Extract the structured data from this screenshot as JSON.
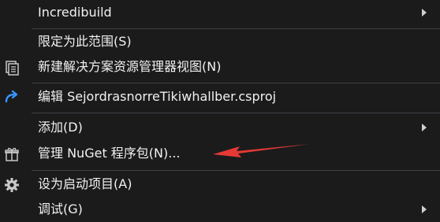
{
  "menu": {
    "items": [
      {
        "label": "Incredibuild",
        "submenu": true
      },
      {
        "label": "限定为此范围(S)"
      },
      {
        "label": "新建解决方案资源管理器视图(N)",
        "icon": "solution-explorer-view-icon"
      },
      {
        "label": "编辑 SejordrasnorreTikiwhallber.csproj",
        "icon": "refresh-arrow-icon"
      },
      {
        "label": "添加(D)",
        "submenu": true
      },
      {
        "label": "管理 NuGet 程序包(N)...",
        "icon": "gift-package-icon"
      },
      {
        "label": "设为启动项目(A)",
        "icon": "gear-icon"
      },
      {
        "label": "调试(G)",
        "submenu": true
      }
    ]
  },
  "colors": {
    "background": "#1b1b1c",
    "text": "#f1f1f1",
    "separator": "#3f3f46",
    "accent_blue": "#3794ff",
    "annotation_red": "#e53935"
  }
}
